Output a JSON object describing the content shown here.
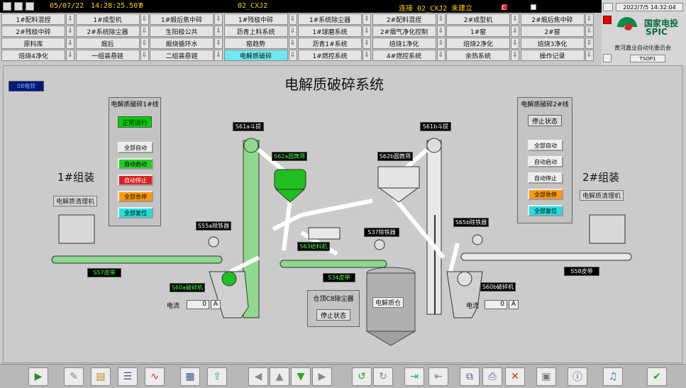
{
  "topbar": {
    "date": "05/07/22",
    "time": "14:28:25.507",
    "zero": "0",
    "station": "02_CXJ2",
    "conn_status": "连接 02_CXJ2 未建立",
    "icon_c": "C",
    "icon_x": "X"
  },
  "nav": {
    "rows": [
      [
        "1#配料混捏",
        "1#成型机",
        "1#煅后焦中碎",
        "1#残极中碎",
        "1#系统除尘器",
        "2#配料混捏",
        "2#成型机",
        "2#煅后焦中碎"
      ],
      [
        "2#残极中碎",
        "2#系统除尘器",
        "生阳极公共",
        "沥青上料系统",
        "1#球磨系统",
        "2#烟气净化控制",
        "1#窑",
        "2#窑"
      ],
      [
        "原料库",
        "煅后",
        "煅烧循环水",
        "窑趋势",
        "沥青1#系统",
        "焙烧1净化",
        "焙烧2净化",
        "焙烧3净化"
      ],
      [
        "焙烧4净化",
        "一组装悬链",
        "二组装悬链",
        "电解质破碎",
        "1#燃控系统",
        "4#燃控系统",
        "余热系统",
        "操作记录"
      ]
    ]
  },
  "logo": {
    "datetime": "2022/7/5 14:32:04",
    "brand_cn": "国家电投",
    "brand_en": "SPIC",
    "company": "黄河鑫业自动化委员会",
    "user": "TSOP1"
  },
  "main": {
    "title": "电解质破碎系统",
    "bell_tag": "08电铃",
    "line1": {
      "title": "电解质破碎1#线",
      "status": "正常运行",
      "buttons": [
        "全部自动",
        "自动启动",
        "自动停止",
        "全部急停",
        "全部复位"
      ],
      "group": "1#组装",
      "cleaner": "电解质清理机"
    },
    "line2": {
      "title": "电解质破碎2#线",
      "status": "停止状态",
      "buttons": [
        "全部自动",
        "自动启动",
        "自动停止",
        "全部急停",
        "全部复位"
      ],
      "group": "2#组装",
      "cleaner": "电解质清理机"
    },
    "tags": {
      "s61a": "S61a斗提",
      "s61b": "S61b斗提",
      "s62a": "S62a圆筒筛",
      "s62b": "S62b圆筒筛",
      "s55a": "S55a除铁器",
      "s65b": "S65b除铁器",
      "s37": "S37除铁器",
      "s63": "S63给料机",
      "s57": "S57皮带",
      "s58": "S58皮带",
      "s34": "S34皮带",
      "s60a": "S60a破碎机",
      "s60b": "S60b破碎机"
    },
    "current_a": {
      "label": "电流",
      "value": "0",
      "unit": "A"
    },
    "current_b": {
      "label": "电流",
      "value": "0",
      "unit": "A"
    },
    "dust": {
      "title": "仓顶C8除尘器",
      "status": "停止状态"
    },
    "silo": "电解质仓"
  },
  "colors": {
    "running": "#00d000",
    "belt": "#8fd88f",
    "panel": "#c3c3c3",
    "silo": "#b0b0b0"
  }
}
